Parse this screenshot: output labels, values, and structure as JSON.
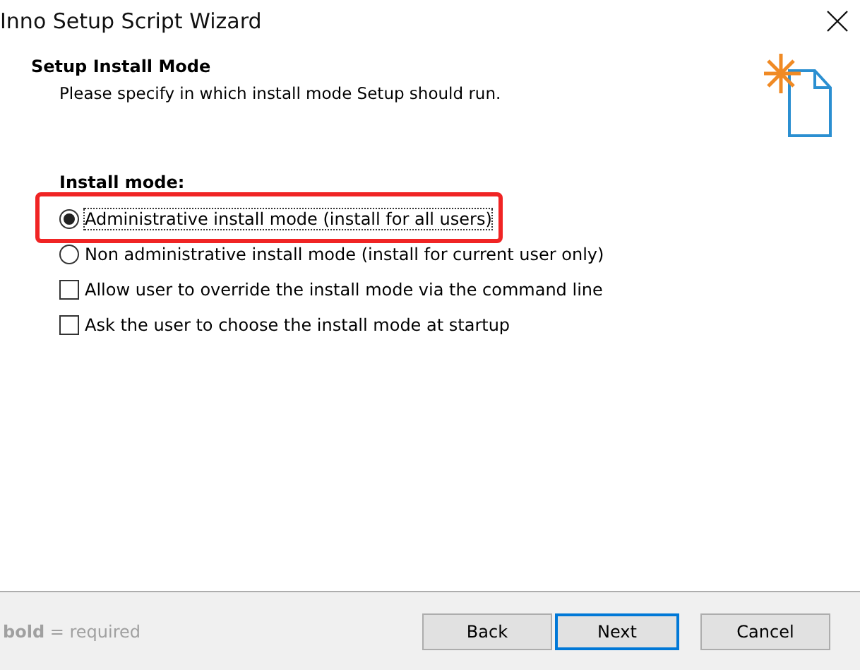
{
  "window": {
    "title": "Inno Setup Script Wizard"
  },
  "page": {
    "title": "Setup Install Mode",
    "subtitle": "Please specify in which install mode Setup should run."
  },
  "group": {
    "label": "Install mode:"
  },
  "options": [
    {
      "kind": "radio",
      "label": "Administrative install mode (install for all users)",
      "selected": true,
      "highlighted": true
    },
    {
      "kind": "radio",
      "label": "Non administrative install mode (install for current user only)",
      "selected": false,
      "highlighted": false
    },
    {
      "kind": "checkbox",
      "label": "Allow user to override the install mode via the command line",
      "checked": false
    },
    {
      "kind": "checkbox",
      "label": "Ask the user to choose the install mode at startup",
      "checked": false
    }
  ],
  "legend": "**bold** = required",
  "buttons": [
    {
      "label": "Back",
      "default": false
    },
    {
      "label": "Next",
      "default": true
    },
    {
      "label": "Cancel",
      "default": false
    }
  ]
}
